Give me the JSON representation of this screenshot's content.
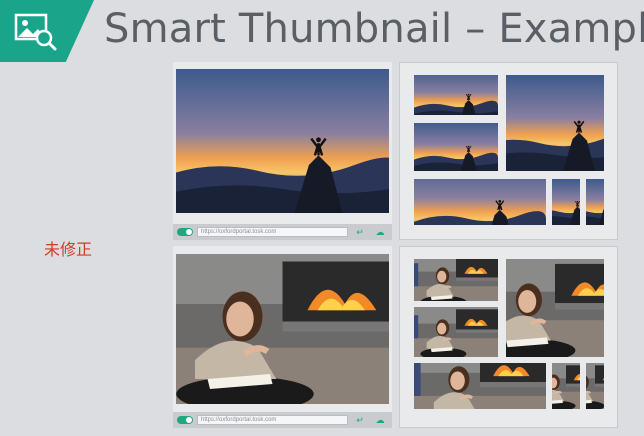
{
  "title": "Smart Thumbnail – Example",
  "side_label": "未修正",
  "logo": {
    "icon": "image-search-icon",
    "color": "#1aa58a"
  },
  "browser_bar": {
    "url_top": "https://oxfordportal.tosk.com",
    "url_bottom": "https://oxfordportal.tosk.com",
    "toggle_icon": "toggle-icon",
    "enter_icon": "enter-arrow-icon",
    "action_icon": "cloud-icon"
  },
  "colors": {
    "accent": "#1aa58a",
    "label": "#d23a2a",
    "title": "#5a5f66"
  }
}
